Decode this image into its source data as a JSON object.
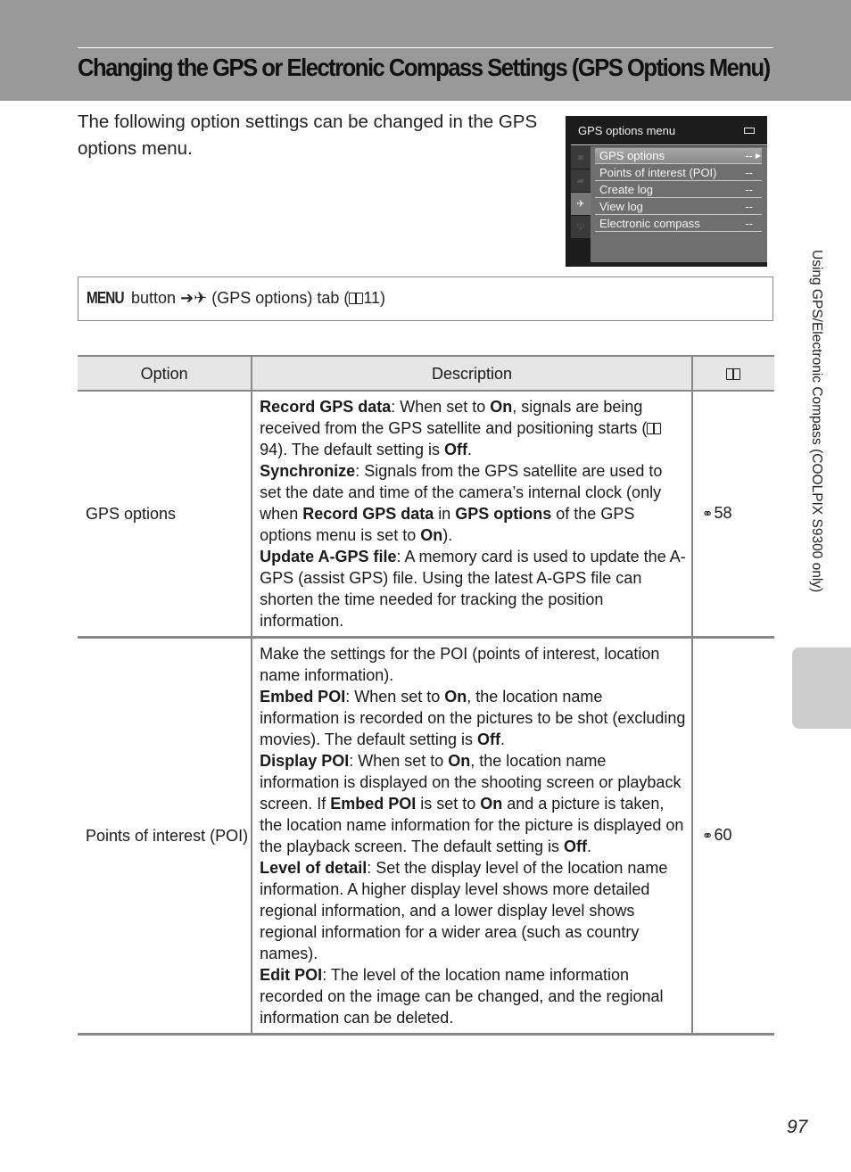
{
  "header": {
    "title": "Changing the GPS or Electronic Compass Settings (GPS Options Menu)"
  },
  "intro": "The following option settings can be changed in the GPS options menu.",
  "camera_screen": {
    "title": "GPS options menu",
    "battery_icon": "battery-icon",
    "tabs": [
      "camera-icon",
      "movie-icon",
      "gps-satellite-icon",
      "wrench-icon"
    ],
    "active_tab": 2,
    "items": [
      {
        "label": "GPS options",
        "value": "--",
        "selected": true
      },
      {
        "label": "Points of interest (POI)",
        "value": "--"
      },
      {
        "label": "Create log",
        "value": "--"
      },
      {
        "label": "View log",
        "value": "--"
      },
      {
        "label": "Electronic compass",
        "value": "--"
      }
    ]
  },
  "path": {
    "menu": "MENU",
    "button": "button",
    "arrow": "➔",
    "tab_icon": "gps-satellite-icon",
    "tab_text": "(GPS options) tab (",
    "ref": "11",
    "close": ")"
  },
  "table": {
    "headers": {
      "option": "Option",
      "description": "Description",
      "ref_icon": "book-icon"
    },
    "rows": [
      {
        "option": "GPS options",
        "ref": "58",
        "description": [
          {
            "t": "Record GPS data",
            "b": true
          },
          {
            "t": ": When set to "
          },
          {
            "t": "On",
            "b": true
          },
          {
            "t": ", signals are being received from the GPS satellite and positioning starts ("
          },
          {
            "book": true
          },
          {
            "t": "94). The default setting is "
          },
          {
            "t": "Off",
            "b": true
          },
          {
            "t": "."
          },
          {
            "br": true
          },
          {
            "t": "Synchronize",
            "b": true
          },
          {
            "t": ": Signals from the GPS satellite are used to set the date and time of the camera’s internal clock (only when "
          },
          {
            "t": "Record GPS data",
            "b": true
          },
          {
            "t": " in "
          },
          {
            "t": "GPS options",
            "b": true
          },
          {
            "t": " of the GPS options menu is set to "
          },
          {
            "t": "On",
            "b": true
          },
          {
            "t": ")."
          },
          {
            "br": true
          },
          {
            "t": "Update A-GPS file",
            "b": true
          },
          {
            "t": ": A memory card is used to update the A-GPS (assist GPS) file. Using the latest A-GPS file can shorten the time needed for tracking the position information."
          }
        ]
      },
      {
        "option": "Points of interest (POI)",
        "ref": "60",
        "description": [
          {
            "t": "Make the settings for the POI (points of interest, location name information)."
          },
          {
            "br": true
          },
          {
            "t": "Embed POI",
            "b": true
          },
          {
            "t": ": When set to "
          },
          {
            "t": "On",
            "b": true
          },
          {
            "t": ", the location name information is recorded on the pictures to be shot (excluding movies). The default setting is "
          },
          {
            "t": "Off",
            "b": true
          },
          {
            "t": "."
          },
          {
            "br": true
          },
          {
            "t": "Display POI",
            "b": true
          },
          {
            "t": ": When set to "
          },
          {
            "t": "On",
            "b": true
          },
          {
            "t": ", the location name information is displayed on the shooting screen or playback screen. If "
          },
          {
            "t": "Embed POI",
            "b": true
          },
          {
            "t": " is set to "
          },
          {
            "t": "On",
            "b": true
          },
          {
            "t": " and a picture is taken, the location name information for the picture is displayed on the playback screen. The default setting is "
          },
          {
            "t": "Off",
            "b": true
          },
          {
            "t": "."
          },
          {
            "br": true
          },
          {
            "t": "Level of detail",
            "b": true
          },
          {
            "t": ": Set the display level of the location name information. A higher display level shows more detailed regional information, and a lower display level shows regional information for a wider area (such as country names)."
          },
          {
            "br": true
          },
          {
            "t": "Edit POI",
            "b": true
          },
          {
            "t": ": The level of the location name information recorded on the image can be changed, and the regional information can be deleted."
          }
        ]
      }
    ]
  },
  "side_label": "Using GPS/Electronic Compass (COOLPIX S9300 only)",
  "page_number": "97"
}
